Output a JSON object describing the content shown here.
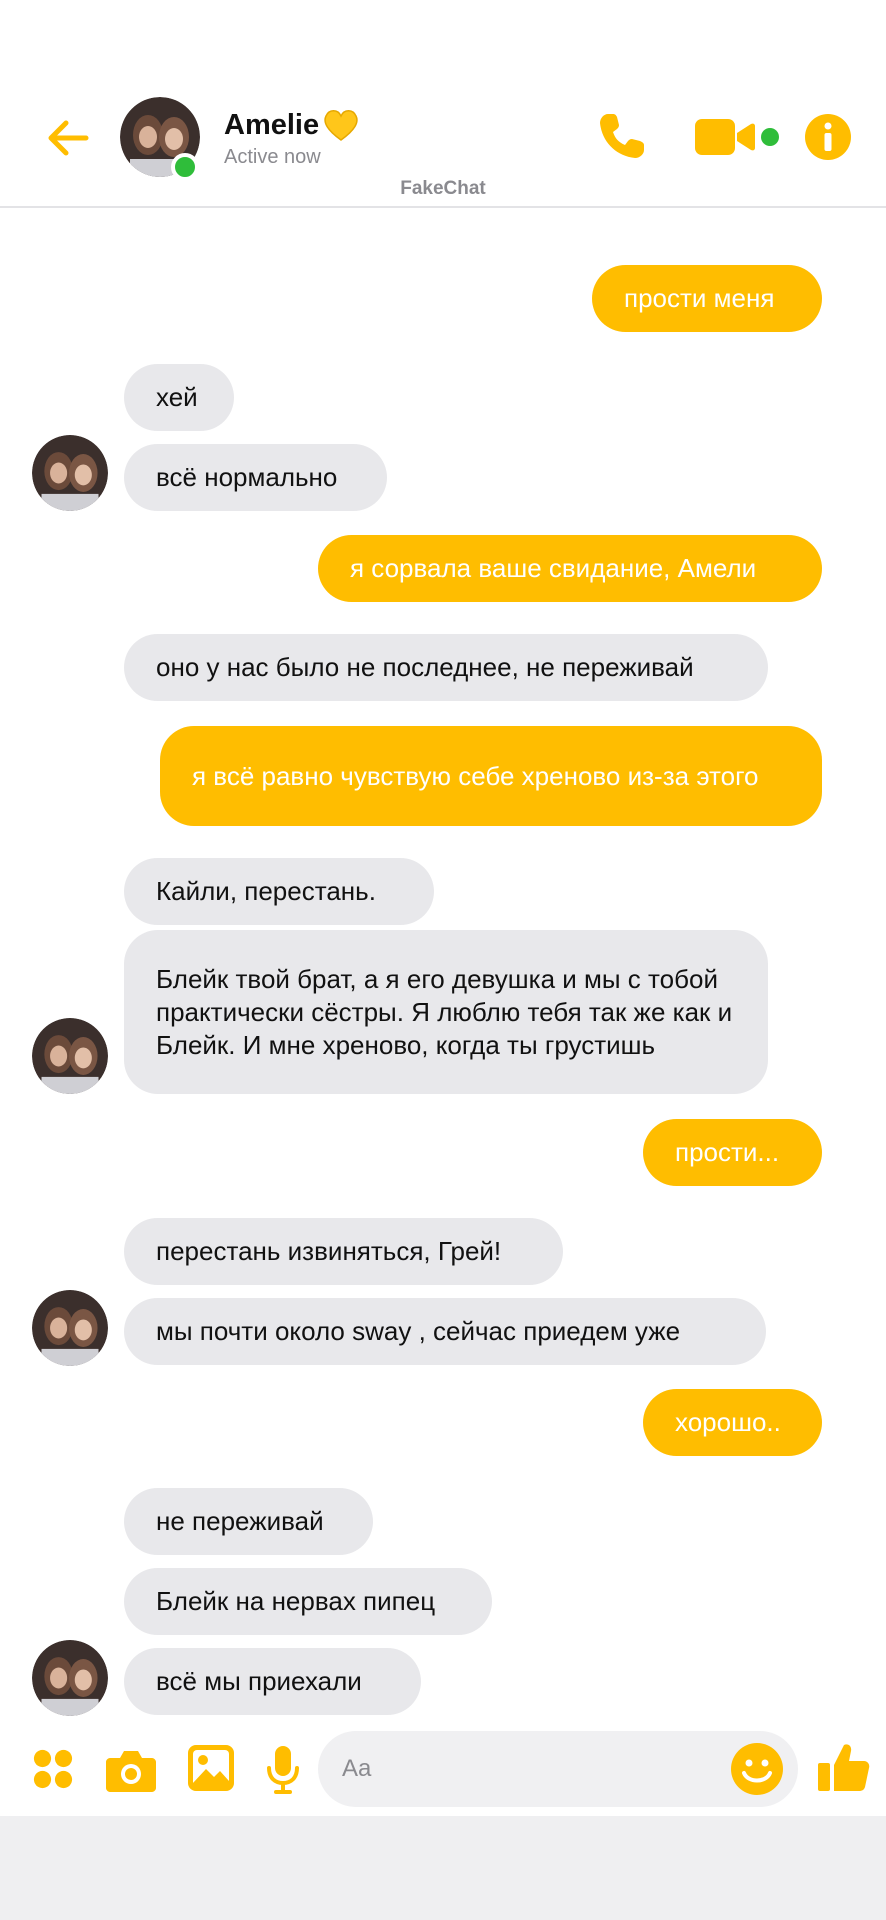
{
  "header": {
    "contact_name": "Amelie",
    "status": "Active now",
    "watermark": "FakeChat",
    "accent_color": "#ffbd00",
    "online_color": "#2fbd3a"
  },
  "messages": [
    {
      "dir": "out",
      "text": "прости меня"
    },
    {
      "dir": "in",
      "text": "хей"
    },
    {
      "dir": "in",
      "text": "всё нормально"
    },
    {
      "dir": "out",
      "text": "я сорвала ваше свидание, Амели"
    },
    {
      "dir": "in",
      "text": "оно у нас было не последнее, не переживай"
    },
    {
      "dir": "out",
      "text": "я всё равно чувствую себе хреново из-за этого"
    },
    {
      "dir": "in",
      "text": "Кайли, перестань."
    },
    {
      "dir": "in",
      "text": "Блейк твой брат, а я его девушка и мы с тобой практически сёстры. Я люблю тебя так же как и Блейк. И мне хреново, когда ты грустишь"
    },
    {
      "dir": "out",
      "text": "прости..."
    },
    {
      "dir": "in",
      "text": "перестань извиняться, Грей!"
    },
    {
      "dir": "in",
      "text": "мы почти около sway , сейчас приедем уже"
    },
    {
      "dir": "out",
      "text": "хорошо.."
    },
    {
      "dir": "in",
      "text": "не переживай"
    },
    {
      "dir": "in",
      "text": "Блейк на нервах пипец"
    },
    {
      "dir": "in",
      "text": "всё мы приехали"
    }
  ],
  "composer": {
    "placeholder": "Aa",
    "icons": [
      "apps-icon",
      "camera-icon",
      "gallery-icon",
      "microphone-icon",
      "emoji-icon",
      "thumbs-up-icon"
    ]
  }
}
